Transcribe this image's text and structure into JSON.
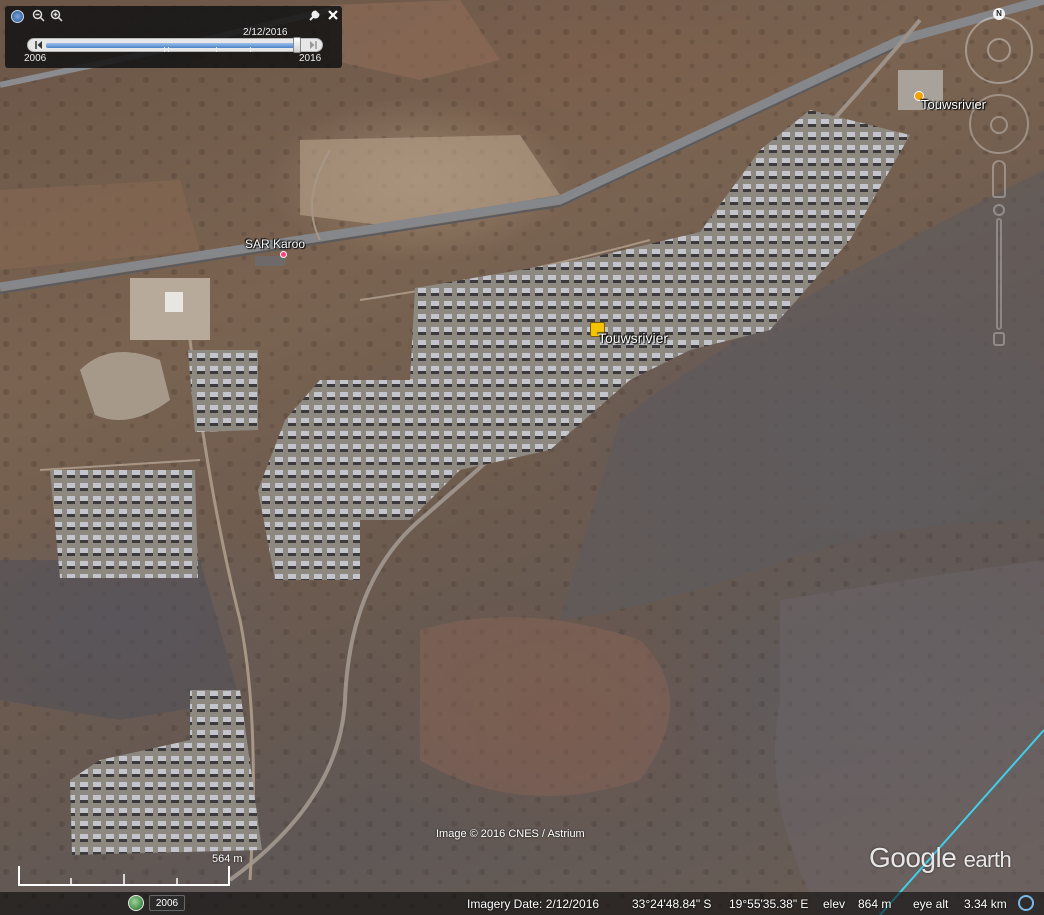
{
  "app": "Google Earth",
  "time_slider": {
    "current_date": "2/12/2016",
    "start_year": "2006",
    "end_year": "2016",
    "position_fraction": 1.0
  },
  "placemarks": {
    "sar_karoo": "SAR Karoo",
    "touwsrivier_center": "Touwsrivier",
    "touwsrivier_ne": "Touwsrivier"
  },
  "navigation": {
    "north": "N"
  },
  "imagery_credit": "Image © 2016 CNES / Astrium",
  "logo": {
    "google": "Google",
    "earth": "earth"
  },
  "scale": {
    "label": "564 m"
  },
  "status_bar": {
    "history_year": "2006",
    "imagery_date": "Imagery Date: 2/12/2016",
    "latitude": "33°24'48.84\" S",
    "longitude": "19°55'35.38\" E",
    "elev_label": "elev",
    "elev_value": "864 m",
    "eye_alt_label": "eye alt",
    "eye_alt_value": "3.34 km"
  },
  "colors": {
    "panel_array": "#9a9aa3",
    "road": "#8a8c90",
    "accent_blue": "#4b82c8",
    "placemark_yellow": "#f5c400",
    "boundary_line": "#3fd0e8"
  }
}
